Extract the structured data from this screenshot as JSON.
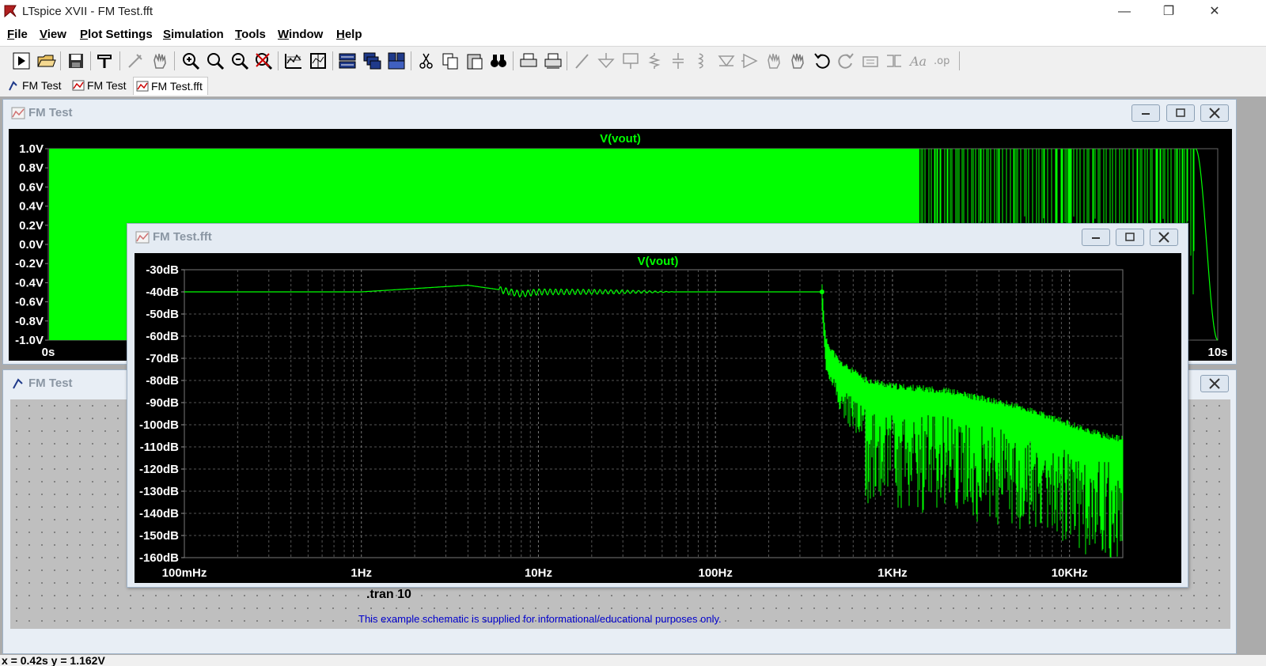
{
  "app": {
    "title": "LTspice XVII - FM Test.fft",
    "window_controls": [
      "minimize",
      "restore",
      "close"
    ]
  },
  "menu": {
    "items": [
      "File",
      "View",
      "Plot Settings",
      "Simulation",
      "Tools",
      "Window",
      "Help"
    ]
  },
  "toolbar": {
    "icons": [
      "run-icon",
      "open-icon",
      "save-icon",
      "settings-hammer-icon",
      "probe-icon",
      "pan-hand-icon",
      "zoom-in-icon",
      "zoom-area-icon",
      "zoom-out-icon",
      "zoom-cancel-icon",
      "autoscale-icon",
      "plot-cursor-icon",
      "tile-horizontal-icon",
      "cascade-icon",
      "tile-vertical-icon",
      "cut-icon",
      "copy-icon",
      "paste-icon",
      "find-icon",
      "print-icon",
      "print-setup-icon",
      "wire-icon",
      "ground-icon",
      "label-net-icon",
      "resistor-icon",
      "capacitor-icon",
      "inductor-icon",
      "diode-icon",
      "component-icon",
      "move-icon",
      "drag-icon",
      "undo-icon",
      "redo-icon",
      "rotate-icon",
      "mirror-icon",
      "text-icon",
      "spice-directive-icon"
    ]
  },
  "tabs": [
    {
      "label": "FM Test",
      "icon": "schematic-icon",
      "active": false
    },
    {
      "label": "FM Test",
      "icon": "waveform-icon",
      "active": false
    },
    {
      "label": "FM Test.fft",
      "icon": "waveform-icon",
      "active": true
    }
  ],
  "windows": {
    "waveform": {
      "title": "FM Test",
      "trace": "V(vout)",
      "y_ticks": [
        "1.0V",
        "0.8V",
        "0.6V",
        "0.4V",
        "0.2V",
        "0.0V",
        "-0.2V",
        "-0.4V",
        "-0.6V",
        "-0.8V",
        "-1.0V"
      ],
      "x_start": "0s",
      "x_end": "10s",
      "trace_color": "#00ff00"
    },
    "schematic": {
      "title": "FM Test",
      "directive": ".tran 10",
      "note": "This example schematic is supplied for informational/educational purposes only."
    },
    "fft": {
      "title": "FM Test.fft",
      "trace": "V(vout)",
      "trace_color": "#00ff00",
      "y_ticks": [
        "-30dB",
        "-40dB",
        "-50dB",
        "-60dB",
        "-70dB",
        "-80dB",
        "-90dB",
        "-100dB",
        "-110dB",
        "-120dB",
        "-130dB",
        "-140dB",
        "-150dB",
        "-160dB"
      ],
      "x_ticks": [
        "100mHz",
        "1Hz",
        "10Hz",
        "100Hz",
        "1KHz",
        "10KHz"
      ]
    }
  },
  "chart_data": [
    {
      "type": "line",
      "title": "V(vout)",
      "xlabel": "",
      "ylabel": "",
      "xlim": [
        0,
        10
      ],
      "ylim": [
        -1.0,
        1.0
      ],
      "x_unit": "s",
      "y_unit": "V",
      "x_tick_labels": [
        "0s",
        "10s"
      ],
      "y_tick_labels": [
        "1.0V",
        "0.8V",
        "0.6V",
        "0.4V",
        "0.2V",
        "0.0V",
        "-0.2V",
        "-0.4V",
        "-0.6V",
        "-0.8V",
        "-1.0V"
      ],
      "grid": false,
      "series": [
        {
          "name": "V(vout)",
          "description_values": {
            "amplitude": 1.0,
            "envelope_min": -1.0,
            "envelope_max": 1.0
          }
        }
      ]
    },
    {
      "type": "line",
      "title": "V(vout)",
      "xlabel": "",
      "ylabel": "",
      "x_scale": "log",
      "xlim": [
        0.1,
        20000
      ],
      "ylim": [
        -160,
        -30
      ],
      "x_tick_labels": [
        "100mHz",
        "1Hz",
        "10Hz",
        "100Hz",
        "1KHz",
        "10KHz"
      ],
      "y_tick_labels": [
        "-30dB",
        "-40dB",
        "-50dB",
        "-60dB",
        "-70dB",
        "-80dB",
        "-90dB",
        "-100dB",
        "-110dB",
        "-120dB",
        "-130dB",
        "-140dB",
        "-150dB",
        "-160dB"
      ],
      "grid": true,
      "series": [
        {
          "name": "V(vout)",
          "x": [
            0.1,
            0.3,
            1,
            2,
            4,
            6,
            8,
            10,
            15,
            30,
            100,
            200,
            400,
            420,
            500,
            700,
            1000,
            2000,
            5000,
            10000,
            15000,
            20000
          ],
          "y": [
            -40,
            -40,
            -40,
            -38.5,
            -37,
            -39,
            -41,
            -40,
            -40,
            -40,
            -40,
            -40,
            -40,
            -65,
            -75,
            -83,
            -86,
            -88,
            -95,
            -103,
            -108,
            -110
          ]
        }
      ]
    }
  ]
}
